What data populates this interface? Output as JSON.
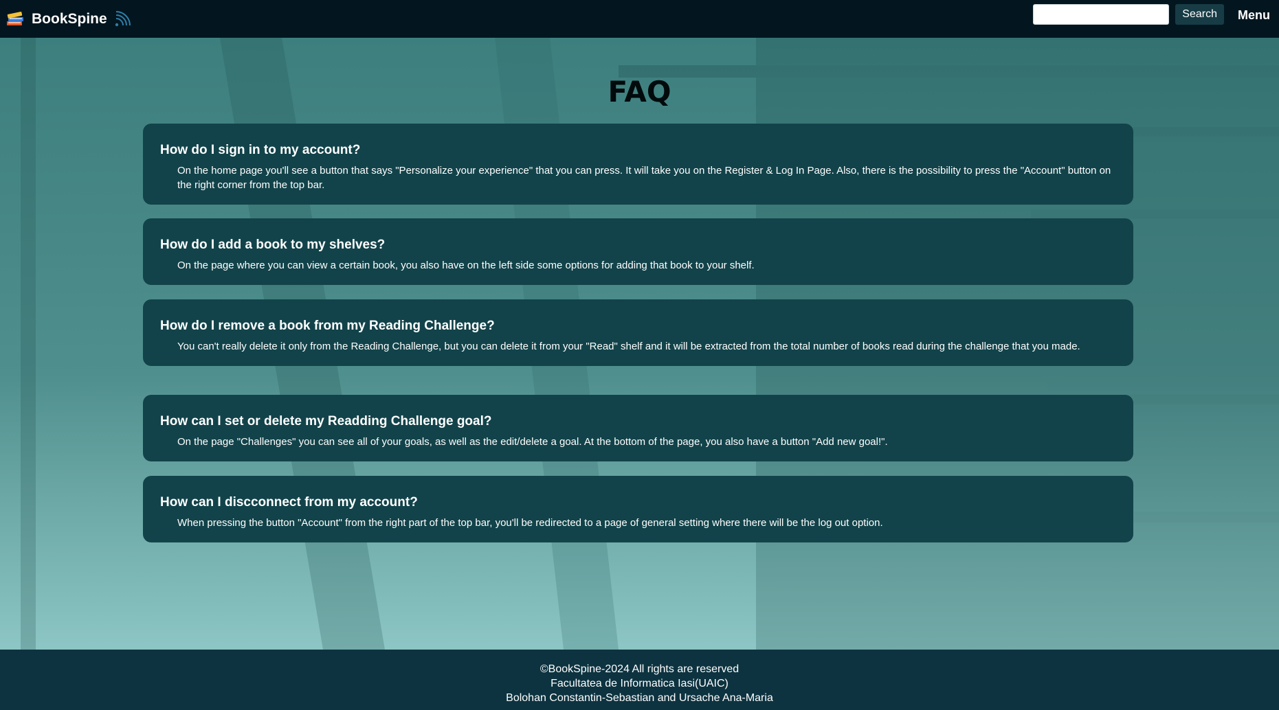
{
  "header": {
    "brand_name": "BookSpine",
    "logo_icon": "stacked-books-icon",
    "feed_icon": "rss-feed-icon",
    "search_placeholder": "",
    "search_button_label": "Search",
    "menu_label": "Menu"
  },
  "page": {
    "title": "FAQ"
  },
  "faq": [
    {
      "question": "How do I sign in to my account?",
      "answer": "On the home page you'll see a button that says \"Personalize your experience\" that you can press. It will take you on the Register & Log In Page. Also, there is the possibility to press the \"Account\" button on the right corner from the top bar."
    },
    {
      "question": "How do I add a book to my shelves?",
      "answer": "On the page where you can view a certain book, you also have on the left side some options for adding that book to your shelf."
    },
    {
      "question": "How do I remove a book from my Reading Challenge?",
      "answer": "You can't really delete it only from the Reading Challenge, but you can delete it from your \"Read\" shelf and it will be extracted from the total number of books read during the challenge that you made."
    },
    {
      "question": "How can I set or delete my Readding Challenge goal?",
      "answer": "On the page \"Challenges\" you can see all of your goals, as well as the edit/delete a goal. At the bottom of the page, you also have a button \"Add new goal!\"."
    },
    {
      "question": "How can I discconnect from my account?",
      "answer": "When pressing the button \"Account\" from the right part of the top bar, you'll be redirected to a page of general setting where there will be the log out option."
    }
  ],
  "footer": {
    "copyright": "©BookSpine-2024 All rights are reserved",
    "institution": "Facultatea de Informatica Iasi(UAIC)",
    "authors": "Bolohan Constantin-Sebastian and Ursache Ana-Maria"
  },
  "colors": {
    "topbar": "#03161f",
    "card": "#12434a",
    "footer": "#0d3340",
    "search_button": "#173c45",
    "feed_icon": "#2f7fa8"
  }
}
